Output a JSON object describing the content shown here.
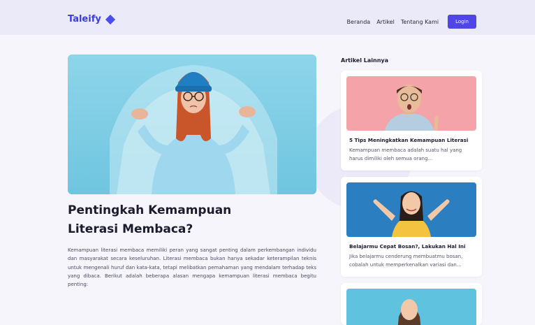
{
  "brand": {
    "name": "Taleify",
    "icon": "diamond-icon",
    "color": "#3a3dd8"
  },
  "nav": {
    "links": [
      "Beranda",
      "Artikel",
      "Tentang Kami"
    ],
    "login_label": "Login",
    "accent": "#4f46e5"
  },
  "article": {
    "hero_image": "woman-shrugging-blue-beanie",
    "title": "Pentingkah Kemampuan Literasi Membaca?",
    "body": "Kemampuan literasi membaca memiliki peran yang sangat penting dalam perkembangan individu dan masyarakat secara keseluruhan. Literasi membaca bukan hanya sekadar keterampilan teknis untuk mengenali huruf dan kata-kata, tetapi melibatkan pemahaman yang mendalam terhadap teks yang dibaca. Berikut adalah beberapa alasan mengapa kemampuan literasi membaca begitu penting:"
  },
  "sidebar": {
    "heading": "Artikel Lainnya",
    "cards": [
      {
        "image": "surprised-man-pink-background",
        "title": "5 Tips Meningkatkan Kemampuan Literasi",
        "excerpt": "Kemampuan membaca adalah suatu hal yang harus dimiliki oleh semua orang..."
      },
      {
        "image": "excited-woman-blue-background",
        "title": "Belajarmu Cepat Bosan?, Lakukan Hal Ini",
        "excerpt": "Jika belajarmu cenderung membuatmu bosan, cobalah untuk memperkenalkan variasi dan..."
      },
      {
        "image": "woman-cyan-background",
        "title": "",
        "excerpt": ""
      }
    ]
  }
}
